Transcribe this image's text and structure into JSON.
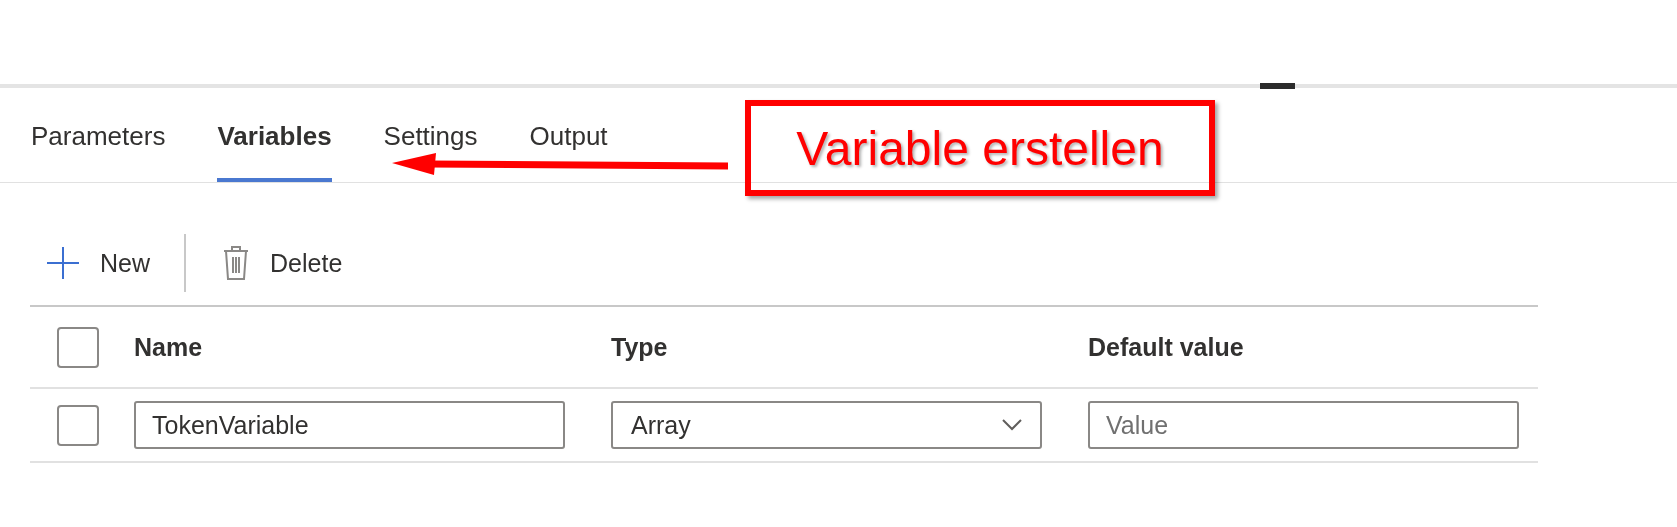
{
  "tabs": [
    {
      "label": "Parameters",
      "selected": false
    },
    {
      "label": "Variables",
      "selected": true
    },
    {
      "label": "Settings",
      "selected": false
    },
    {
      "label": "Output",
      "selected": false
    }
  ],
  "toolbar": {
    "buttons": [
      {
        "label": "New",
        "kind": "add"
      },
      {
        "label": "Delete",
        "kind": "delete"
      }
    ]
  },
  "table": {
    "columns": [
      "Name",
      "Type",
      "Default value"
    ],
    "header_checked": false,
    "rows": [
      {
        "checked": false,
        "name": "TokenVariable",
        "type": "Array",
        "default_value": {
          "placeholder": "Value"
        }
      }
    ]
  },
  "annotation": {
    "text": "Variable erstellen"
  }
}
